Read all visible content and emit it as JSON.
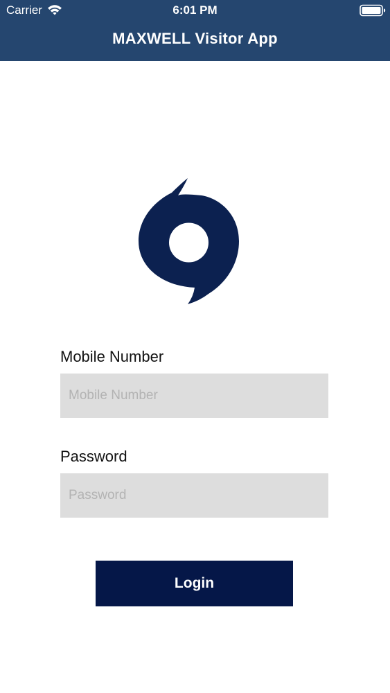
{
  "status_bar": {
    "carrier": "Carrier",
    "wifi_icon": "wifi-icon",
    "time": "6:01 PM",
    "battery_icon": "battery-full-icon"
  },
  "header": {
    "title": "MAXWELL Visitor App",
    "background_color": "#25466f"
  },
  "logo": {
    "icon": "hurricane-logo",
    "color": "#0c2150"
  },
  "form": {
    "mobile": {
      "label": "Mobile Number",
      "placeholder": "Mobile Number",
      "value": ""
    },
    "password": {
      "label": "Password",
      "placeholder": "Password",
      "value": ""
    },
    "field_background": "#dddddd",
    "login_label": "Login",
    "login_color": "#051748"
  }
}
